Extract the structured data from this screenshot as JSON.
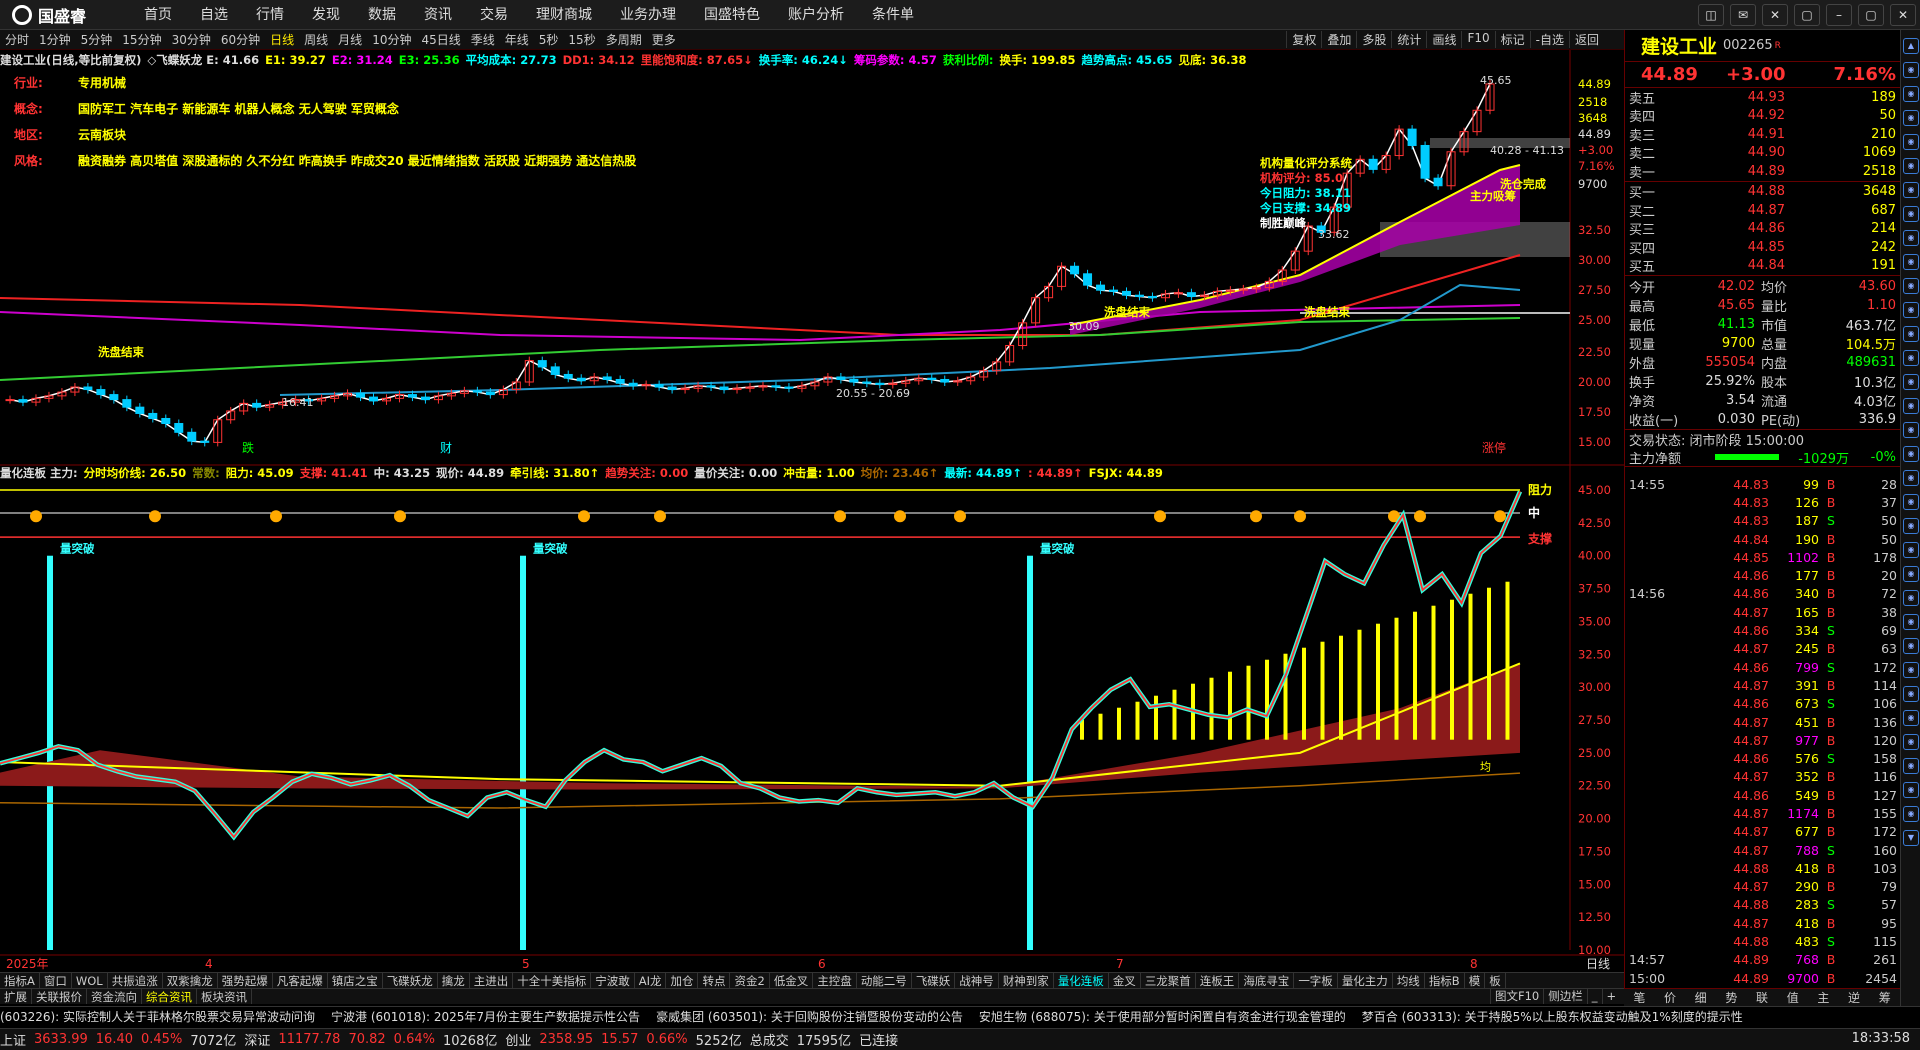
{
  "logo": "国盛睿",
  "menu": [
    "首页",
    "自选",
    "行情",
    "发现",
    "数据",
    "资讯",
    "交易",
    "理财商城",
    "业务办理",
    "国盛特色",
    "账户分析",
    "条件单"
  ],
  "win_buttons": [
    "◫",
    "✉",
    "✕",
    "▢",
    "–",
    "▢",
    "✕"
  ],
  "periods": [
    "分时",
    "1分钟",
    "5分钟",
    "15分钟",
    "30分钟",
    "60分钟",
    "日线",
    "周线",
    "月线",
    "10分钟",
    "45日线",
    "季线",
    "年线",
    "5秒",
    "15秒",
    "多周期",
    "更多"
  ],
  "active_period": "日线",
  "right_tools": [
    "复权",
    "叠加",
    "多股",
    "统计",
    "画线",
    "F10",
    "标记",
    "-自选",
    "返回"
  ],
  "info": [
    {
      "t": "建设工业(日线,等比前复权)",
      "c": "#ddd"
    },
    {
      "t": "◇飞蝶妖龙 E: 41.66",
      "c": "#ddd"
    },
    {
      "t": "E1: 39.27",
      "c": "#ff0"
    },
    {
      "t": "E2: 31.24",
      "c": "#f0f"
    },
    {
      "t": "E3: 25.36",
      "c": "#0f0"
    },
    {
      "t": "平均成本: 27.73",
      "c": "#0ff"
    },
    {
      "t": "DD1: 34.12",
      "c": "#f33"
    },
    {
      "t": "里能饱和度: 87.65↓",
      "c": "#f33"
    },
    {
      "t": "换手率: 46.24↓",
      "c": "#0ff"
    },
    {
      "t": "筹码参数: 4.57",
      "c": "#f0f"
    },
    {
      "t": "获利比例:",
      "c": "#0f0"
    },
    {
      "t": "换手: 199.85",
      "c": "#ff0"
    },
    {
      "t": "趋势高点: 45.65",
      "c": "#0ff"
    },
    {
      "t": "见底: 36.38",
      "c": "#ff0"
    }
  ],
  "tags": [
    {
      "k": "行业:",
      "v": "专用机械"
    },
    {
      "k": "概念:",
      "v": "国防军工 汽车电子 新能源车 机器人概念 无人驾驶 军贸概念"
    },
    {
      "k": "地区:",
      "v": "云南板块"
    },
    {
      "k": "风格:",
      "v": "融资融券 高贝塔值 深股通标的 久不分红 昨高换手 昨成交20 最近情绪指数 活跃股 近期强势 通达信热股"
    }
  ],
  "annot": {
    "model": "机构量化评分系统",
    "score": "机构评分: 85.0",
    "res": "今日阻力: 38.11",
    "sup": "今日支撑: 34.89",
    "win": "制胜巅峰",
    "hi": "45.65",
    "rng": "40.28 - 41.13",
    "low1": "16.41",
    "low2": "20.55 - 20.69",
    "v1": "33.62",
    "v2": "30.09",
    "w1": "洗盘结束",
    "w2": "洗盘结束",
    "w3": "洗盘结束",
    "main": "主力吸筹",
    "wash": "洗仓完成",
    "die": "跌",
    "cai": "财",
    "zhangting": "涨停"
  },
  "sub_info": [
    {
      "t": "量化连板 主力:",
      "c": "#ddd"
    },
    {
      "t": "分时均价线: 26.50",
      "c": "#ff0"
    },
    {
      "t": "常数:",
      "c": "#880"
    },
    {
      "t": "阻力: 45.09",
      "c": "#ff0"
    },
    {
      "t": "支撑: 41.41",
      "c": "#f33"
    },
    {
      "t": "中: 43.25",
      "c": "#ddd"
    },
    {
      "t": "现价: 44.89",
      "c": "#ddd"
    },
    {
      "t": "牵引线: 31.80↑",
      "c": "#ff0"
    },
    {
      "t": "趋势关注: 0.00",
      "c": "#f33"
    },
    {
      "t": "量价关注: 0.00",
      "c": "#ddd"
    },
    {
      "t": "冲击量: 1.00",
      "c": "#ff0"
    },
    {
      "t": "均价: 23.46↑",
      "c": "#a60"
    },
    {
      "t": "最新: 44.89↑",
      "c": "#0ff"
    },
    {
      "t": ": 44.89↑",
      "c": "#f33"
    },
    {
      "t": "FSJX: 44.89",
      "c": "#ff0"
    }
  ],
  "sub_annot": {
    "zuli": "阻力",
    "zhong": "中",
    "zhicheng": "支撑",
    "tp": "量突破",
    "jun": "均"
  },
  "main_axis": [
    {
      "v": "44.89",
      "c": "#ff0"
    },
    {
      "v": "2518",
      "c": "#ff0"
    },
    {
      "v": "3648",
      "c": "#ff0"
    },
    {
      "v": "44.89",
      "c": "#ddd"
    },
    {
      "v": "+3.00",
      "c": "#f33"
    },
    {
      "v": "7.16%",
      "c": "#f33"
    },
    {
      "v": "9700",
      "c": "#ddd"
    },
    {
      "v": "32.50",
      "c": "#f33"
    },
    {
      "v": "30.00",
      "c": "#f33"
    },
    {
      "v": "27.50",
      "c": "#f33"
    },
    {
      "v": "25.00",
      "c": "#f33"
    },
    {
      "v": "22.50",
      "c": "#f33"
    },
    {
      "v": "20.00",
      "c": "#f33"
    },
    {
      "v": "17.50",
      "c": "#f33"
    },
    {
      "v": "15.00",
      "c": "#f33"
    }
  ],
  "sub_axis": [
    "45.00",
    "42.50",
    "40.00",
    "37.50",
    "35.00",
    "32.50",
    "30.00",
    "27.50",
    "25.00",
    "22.50",
    "20.00",
    "17.50",
    "15.00",
    "12.50",
    "10.00"
  ],
  "dates": [
    "2025年",
    "4",
    "5",
    "6",
    "7",
    "8"
  ],
  "period_label": "日线",
  "stock": {
    "name": "建设工业",
    "code": "002265",
    "badge": "R",
    "price": "44.89",
    "chg": "+3.00",
    "pct": "7.16%"
  },
  "asks": [
    {
      "l": "卖五",
      "p": "44.93",
      "v": "189"
    },
    {
      "l": "卖四",
      "p": "44.92",
      "v": "50"
    },
    {
      "l": "卖三",
      "p": "44.91",
      "v": "210"
    },
    {
      "l": "卖二",
      "p": "44.90",
      "v": "1069"
    },
    {
      "l": "卖一",
      "p": "44.89",
      "v": "2518"
    }
  ],
  "bids": [
    {
      "l": "买一",
      "p": "44.88",
      "v": "3648"
    },
    {
      "l": "买二",
      "p": "44.87",
      "v": "687"
    },
    {
      "l": "买三",
      "p": "44.86",
      "v": "214"
    },
    {
      "l": "买四",
      "p": "44.85",
      "v": "242"
    },
    {
      "l": "买五",
      "p": "44.84",
      "v": "191"
    }
  ],
  "stats": [
    {
      "a": "今开",
      "b": "42.02",
      "bc": "red",
      "c": "均价",
      "d": "43.60",
      "dc": "red"
    },
    {
      "a": "最高",
      "b": "45.65",
      "bc": "red",
      "c": "量比",
      "d": "1.10",
      "dc": "red"
    },
    {
      "a": "最低",
      "b": "41.13",
      "bc": "grn",
      "c": "市值",
      "d": "463.7亿",
      "dc": "wht"
    },
    {
      "a": "现量",
      "b": "9700",
      "bc": "yel",
      "c": "总量",
      "d": "104.5万",
      "dc": "yel"
    },
    {
      "a": "外盘",
      "b": "555054",
      "bc": "red",
      "c": "内盘",
      "d": "489631",
      "dc": "grn"
    },
    {
      "a": "换手",
      "b": "25.92%",
      "bc": "wht",
      "c": "股本",
      "d": "10.3亿",
      "dc": "wht"
    },
    {
      "a": "净资",
      "b": "3.54",
      "bc": "wht",
      "c": "流通",
      "d": "4.03亿",
      "dc": "wht"
    },
    {
      "a": "收益(一)",
      "b": "0.030",
      "bc": "wht",
      "c": "PE(动)",
      "d": "336.9",
      "dc": "wht"
    }
  ],
  "trade_status": "交易状态: 闭市阶段 15:00:00",
  "netflow_label": "主力净额",
  "netflow_val": "-1029万",
  "netflow_pct": "-0%",
  "ticks": [
    {
      "t": "14:55",
      "p": "44.83",
      "v": "99",
      "s": "B",
      "n": "28"
    },
    {
      "t": "",
      "p": "44.83",
      "v": "126",
      "s": "B",
      "n": "37"
    },
    {
      "t": "",
      "p": "44.83",
      "v": "187",
      "s": "S",
      "n": "50"
    },
    {
      "t": "",
      "p": "44.84",
      "v": "190",
      "s": "B",
      "n": "50"
    },
    {
      "t": "",
      "p": "44.85",
      "v": "1102",
      "s": "B",
      "n": "178"
    },
    {
      "t": "",
      "p": "44.86",
      "v": "177",
      "s": "B",
      "n": "20"
    },
    {
      "t": "14:56",
      "p": "44.86",
      "v": "340",
      "s": "B",
      "n": "72"
    },
    {
      "t": "",
      "p": "44.87",
      "v": "165",
      "s": "B",
      "n": "38"
    },
    {
      "t": "",
      "p": "44.86",
      "v": "334",
      "s": "S",
      "n": "69"
    },
    {
      "t": "",
      "p": "44.87",
      "v": "245",
      "s": "B",
      "n": "63"
    },
    {
      "t": "",
      "p": "44.86",
      "v": "799",
      "s": "S",
      "n": "172"
    },
    {
      "t": "",
      "p": "44.87",
      "v": "391",
      "s": "B",
      "n": "114"
    },
    {
      "t": "",
      "p": "44.86",
      "v": "673",
      "s": "S",
      "n": "106"
    },
    {
      "t": "",
      "p": "44.87",
      "v": "451",
      "s": "B",
      "n": "136"
    },
    {
      "t": "",
      "p": "44.87",
      "v": "977",
      "s": "B",
      "n": "120"
    },
    {
      "t": "",
      "p": "44.86",
      "v": "576",
      "s": "S",
      "n": "158"
    },
    {
      "t": "",
      "p": "44.87",
      "v": "352",
      "s": "B",
      "n": "116"
    },
    {
      "t": "",
      "p": "44.86",
      "v": "549",
      "s": "B",
      "n": "127"
    },
    {
      "t": "",
      "p": "44.87",
      "v": "1174",
      "s": "B",
      "n": "155"
    },
    {
      "t": "",
      "p": "44.87",
      "v": "677",
      "s": "B",
      "n": "172"
    },
    {
      "t": "",
      "p": "44.87",
      "v": "788",
      "s": "S",
      "n": "160"
    },
    {
      "t": "",
      "p": "44.88",
      "v": "418",
      "s": "B",
      "n": "103"
    },
    {
      "t": "",
      "p": "44.87",
      "v": "290",
      "s": "B",
      "n": "79"
    },
    {
      "t": "",
      "p": "44.88",
      "v": "283",
      "s": "S",
      "n": "57"
    },
    {
      "t": "",
      "p": "44.87",
      "v": "418",
      "s": "B",
      "n": "95"
    },
    {
      "t": "",
      "p": "44.88",
      "v": "483",
      "s": "S",
      "n": "115"
    },
    {
      "t": "14:57",
      "p": "44.89",
      "v": "768",
      "s": "B",
      "n": "261"
    },
    {
      "t": "15:00",
      "p": "44.89",
      "v": "9700",
      "s": "B",
      "n": "2454"
    }
  ],
  "panel_tabs": [
    "笔",
    "价",
    "细",
    "势",
    "联",
    "值",
    "主",
    "逆",
    "筹"
  ],
  "ind_tabs": [
    "指标A",
    "窗口",
    "WOL",
    "共振追涨",
    "双紫擒龙",
    "强势起爆",
    "凡客起爆",
    "镇店之宝",
    "飞碟妖龙",
    "擒龙",
    "主进出",
    "十全十美指标",
    "宁波敢",
    "AI龙",
    "加仓",
    "转点",
    "资金2",
    "低金叉",
    "主控盘",
    "动能二号",
    "飞碟妖",
    "战神号",
    "财神到家",
    "量化连板",
    "金叉",
    "三龙聚首",
    "连板王",
    "海底寻宝",
    "一字板",
    "量化主力",
    "均线",
    "指标B",
    "模",
    "板"
  ],
  "ind_active": "量化连板",
  "bot_tabs": [
    "扩展",
    "关联报价",
    "资金流向",
    "综合资讯",
    "板块资讯"
  ],
  "bot_active": "综合资讯",
  "bot_right": [
    "图文F10",
    "侧边栏",
    "_",
    "+"
  ],
  "news": [
    "(603226): 实际控制人关于菲林格尔股票交易异常波动问询",
    "宁波港 (601018): 2025年7月份主要生产数据提示性公告",
    "豪威集团 (603501): 关于回购股份注销暨股份变动的公告",
    "安旭生物 (688075): 关于使用部分暂时闲置自有资金进行现金管理的",
    "梦百合 (603313): 关于持股5%以上股东权益变动触及1%刻度的提示性"
  ],
  "status": [
    {
      "t": "上证",
      "c": "#ddd"
    },
    {
      "t": "3633.99",
      "c": "#f33"
    },
    {
      "t": "16.40",
      "c": "#f33"
    },
    {
      "t": "0.45%",
      "c": "#f33"
    },
    {
      "t": "7072亿",
      "c": "#ddd"
    },
    {
      "t": "深证",
      "c": "#ddd"
    },
    {
      "t": "11177.78",
      "c": "#f33"
    },
    {
      "t": "70.82",
      "c": "#f33"
    },
    {
      "t": "0.64%",
      "c": "#f33"
    },
    {
      "t": "10268亿",
      "c": "#ddd"
    },
    {
      "t": "创业",
      "c": "#ddd"
    },
    {
      "t": "2358.95",
      "c": "#f33"
    },
    {
      "t": "15.57",
      "c": "#f33"
    },
    {
      "t": "0.66%",
      "c": "#f33"
    },
    {
      "t": "5252亿",
      "c": "#ddd"
    },
    {
      "t": "总成交",
      "c": "#ddd"
    },
    {
      "t": "17595亿",
      "c": "#ddd"
    },
    {
      "t": "已连接",
      "c": "#ddd"
    }
  ],
  "clock": "18:33:58",
  "chart_data": {
    "type": "line",
    "candles": [
      19.8,
      19.6,
      19.9,
      20.1,
      20.4,
      20.8,
      20.6,
      20.2,
      19.8,
      19.2,
      18.7,
      18.3,
      17.9,
      17.2,
      16.5,
      16.4,
      18.2,
      18.9,
      19.5,
      19.2,
      19.4,
      19.6,
      19.8,
      19.7,
      19.9,
      20.1,
      20.3,
      20.0,
      19.7,
      19.9,
      20.2,
      20.0,
      19.8,
      20.1,
      20.3,
      20.5,
      20.4,
      20.2,
      20.6,
      21.2,
      22.9,
      22.4,
      21.8,
      21.5,
      21.3,
      21.6,
      21.4,
      21.1,
      20.9,
      21.0,
      20.8,
      20.6,
      20.7,
      20.9,
      20.8,
      20.6,
      20.7,
      20.8,
      20.9,
      20.8,
      20.7,
      20.9,
      21.2,
      21.6,
      21.4,
      21.2,
      21.1,
      21.0,
      21.1,
      21.3,
      21.5,
      21.4,
      21.2,
      21.3,
      21.6,
      22.1,
      22.8,
      24.1,
      25.9,
      27.9,
      28.8,
      30.4,
      29.8,
      28.9,
      28.5,
      28.4,
      28.1,
      28.0,
      27.9,
      28.2,
      28.3,
      28.0,
      28.1,
      28.4,
      28.5,
      28.6,
      28.7,
      29.2,
      30.1,
      31.6,
      33.6,
      33.1,
      35.1,
      37.8,
      38.9,
      38.1,
      39.2,
      41.3,
      40.0,
      37.4,
      36.8,
      39.5,
      41.1,
      42.8,
      44.89
    ],
    "sub_line": [
      24.2,
      24.6,
      25.0,
      25.5,
      25.2,
      24.1,
      23.6,
      23.2,
      23.0,
      22.8,
      22.1,
      20.4,
      18.6,
      20.5,
      21.6,
      22.8,
      23.4,
      23.1,
      22.6,
      22.9,
      23.3,
      22.5,
      21.4,
      20.8,
      20.2,
      21.6,
      22.0,
      21.4,
      20.9,
      22.9,
      24.3,
      25.2,
      24.5,
      24.3,
      23.6,
      24.1,
      24.6,
      24.0,
      22.7,
      22.3,
      21.6,
      21.3,
      21.4,
      21.2,
      22.3,
      22.0,
      21.8,
      21.9,
      22.0,
      21.7,
      22.0,
      22.7,
      21.6,
      20.9,
      23.1,
      26.8,
      28.4,
      29.8,
      30.6,
      28.5,
      28.7,
      28.3,
      27.9,
      27.7,
      28.3,
      27.8,
      31.0,
      35.3,
      39.6,
      38.6,
      37.9,
      40.8,
      43.1,
      37.4,
      38.6,
      36.4,
      40.2,
      41.5,
      44.89
    ],
    "sub_ylim": [
      10,
      45
    ],
    "main_ylim": [
      15,
      46
    ]
  }
}
